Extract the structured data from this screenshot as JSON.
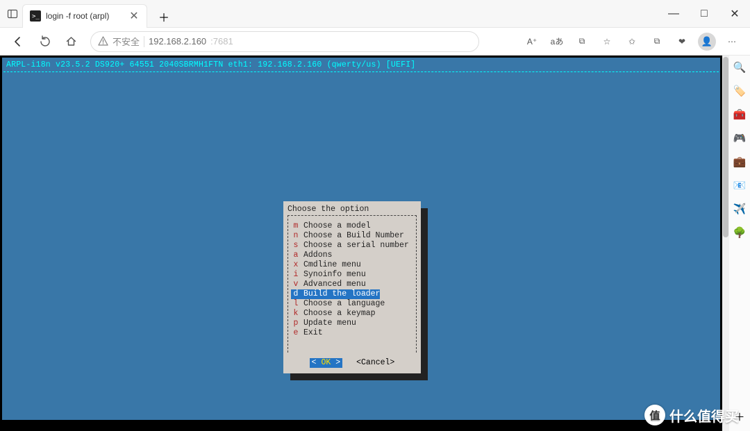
{
  "window": {
    "tab_title": "login -f root (arpl)",
    "minimize_glyph": "—",
    "maximize_glyph": "□",
    "close_glyph": "✕",
    "newtab_glyph": "＋",
    "tabclose_glyph": "✕"
  },
  "toolbar": {
    "security_label": "不安全",
    "url_host": "192.168.2.160",
    "url_port": ":7681",
    "icons": {
      "read_aloud": "A⁺",
      "translate": "aあ",
      "split": "⧉",
      "favorite": "☆",
      "favorites_list": "✩",
      "collections": "⧉",
      "perf": "❤",
      "menu": "⋯"
    }
  },
  "sidebar": {
    "search": "🔍",
    "shopping": "🏷️",
    "tools": "🧰",
    "games": "🎮",
    "wallet": "💼",
    "outlook": "📧",
    "telegram": "✈️",
    "tree": "🌳",
    "plus": "＋"
  },
  "terminal": {
    "header": "ARPL-i18n v23.5.2 DS920+ 64551 2040SBRMH1FTN eth1: 192.168.2.160 (qwerty/us) [UEFI]"
  },
  "dialog": {
    "title": "Choose the option",
    "items": [
      {
        "key": "m",
        "label": "Choose a model"
      },
      {
        "key": "n",
        "label": "Choose a Build Number"
      },
      {
        "key": "s",
        "label": "Choose a serial number"
      },
      {
        "key": "a",
        "label": "Addons"
      },
      {
        "key": "x",
        "label": "Cmdline menu"
      },
      {
        "key": "i",
        "label": "Synoinfo menu"
      },
      {
        "key": "v",
        "label": "Advanced menu"
      },
      {
        "key": "d",
        "label": "Build the loader"
      },
      {
        "key": "l",
        "label": "Choose a language"
      },
      {
        "key": "k",
        "label": "Choose a keymap"
      },
      {
        "key": "p",
        "label": "Update menu"
      },
      {
        "key": "e",
        "label": "Exit"
      }
    ],
    "selected_index": 7,
    "ok_label": "OK",
    "cancel_label": "<Cancel>"
  },
  "watermark": {
    "badge": "值",
    "text": "什么值得买"
  }
}
